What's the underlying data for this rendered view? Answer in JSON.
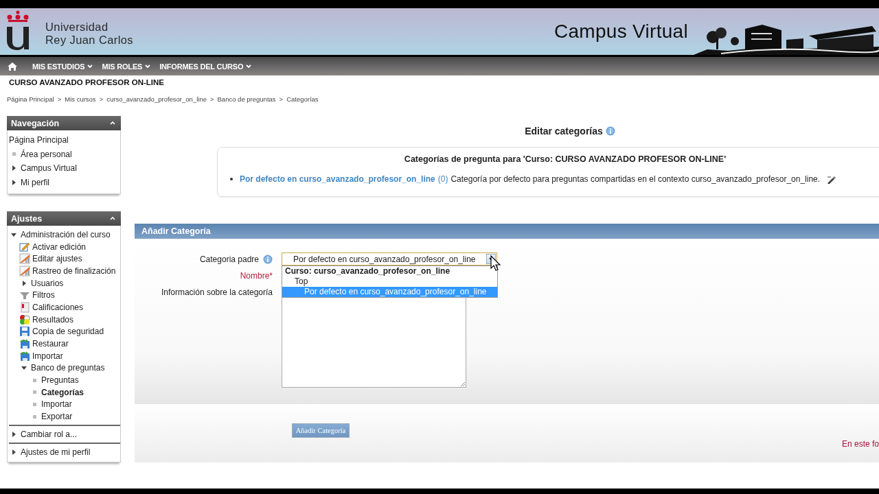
{
  "header": {
    "university_name": [
      "Universidad",
      "Rey Juan Carlos"
    ],
    "site_title": "Campus Virtual"
  },
  "menu": [
    "MIS ESTUDIOS",
    "MIS ROLES",
    "INFORMES DEL CURSO"
  ],
  "course_title": "CURSO AVANZADO PROFESOR ON-LINE",
  "breadcrumb": {
    "separator": ">",
    "items": [
      "Página Principal",
      "Mis cursos",
      "curso_avanzado_profesor_on_line",
      "Banco de preguntas",
      "Categorías"
    ]
  },
  "blocks": [
    {
      "title": "Navegación",
      "separated": false,
      "items": [
        {
          "label": "Página Principal",
          "kind": "plain",
          "selected": false
        },
        {
          "label": "Área personal",
          "kind": "bullet",
          "selected": false
        },
        {
          "label": "Campus Virtual",
          "kind": "branch",
          "expanded": false,
          "selected": false
        },
        {
          "label": "Mi perfil",
          "kind": "branch",
          "expanded": false,
          "selected": false
        }
      ]
    },
    {
      "title": "Ajustes",
      "separated": true,
      "items": [
        {
          "label": "Administración del curso",
          "kind": "branch",
          "expanded": true,
          "selected": false,
          "children": [
            {
              "label": "Activar edición",
              "kind": "pencil",
              "selected": false
            },
            {
              "label": "Editar ajustes",
              "kind": "chart",
              "selected": false
            },
            {
              "label": "Rastreo de finalización",
              "kind": "chart",
              "selected": false
            },
            {
              "label": "Usuarios",
              "kind": "branch",
              "expanded": false,
              "selected": false
            },
            {
              "label": "Filtros",
              "kind": "filter",
              "selected": false
            },
            {
              "label": "Calificaciones",
              "kind": "grades",
              "selected": false
            },
            {
              "label": "Resultados",
              "kind": "dots",
              "selected": false
            },
            {
              "label": "Copia de seguridad",
              "kind": "disk",
              "selected": false
            },
            {
              "label": "Restaurar",
              "kind": "restore",
              "selected": false
            },
            {
              "label": "Importar",
              "kind": "restore",
              "selected": false
            },
            {
              "label": "Banco de preguntas",
              "kind": "branch",
              "expanded": true,
              "selected": false,
              "children": [
                {
                  "label": "Preguntas",
                  "kind": "bullet",
                  "selected": false
                },
                {
                  "label": "Categorías",
                  "kind": "bullet",
                  "selected": true
                },
                {
                  "label": "Importar",
                  "kind": "bullet",
                  "selected": false
                },
                {
                  "label": "Exportar",
                  "kind": "bullet",
                  "selected": false
                }
              ]
            }
          ]
        },
        {
          "label": "Cambiar rol a...",
          "kind": "branch",
          "expanded": false,
          "selected": false
        },
        {
          "label": "Ajustes de mi perfil",
          "kind": "branch",
          "expanded": false,
          "selected": false
        }
      ]
    }
  ],
  "page_heading": "Editar categorías",
  "category_box": {
    "heading": "Categorías de pregunta para 'Curso: CURSO AVANZADO PROFESOR ON-LINE'",
    "items": [
      {
        "name": "Por defecto en curso_avanzado_profesor_on_line",
        "count": "(0)",
        "description": "Categoría por defecto para preguntas compartidas en el contexto curso_avanzado_profesor_on_line."
      }
    ]
  },
  "form": {
    "title": "Añadir Categoría",
    "fields": [
      {
        "kind": "select",
        "label": "Categoria padre",
        "help": true,
        "required": false,
        "value": "Por defecto en curso_avanzado_profesor_on_line",
        "expanded": true,
        "options": [
          {
            "label": "Curso: curso_avanzado_profesor_on_line",
            "kind": "group",
            "children": [
              {
                "label": "Top",
                "kind": "option",
                "selected": false,
                "children": [
                  {
                    "label": "Por defecto en curso_avanzado_profesor_on_line",
                    "kind": "option",
                    "selected": true
                  }
                ]
              }
            ]
          }
        ]
      },
      {
        "kind": "text",
        "label": "Nombre*",
        "help": false,
        "required": true
      },
      {
        "kind": "textarea",
        "label": "Información sobre la categoría",
        "help": false,
        "required": false
      }
    ],
    "submit": "Añadir Categoría",
    "note": "En este fo"
  }
}
